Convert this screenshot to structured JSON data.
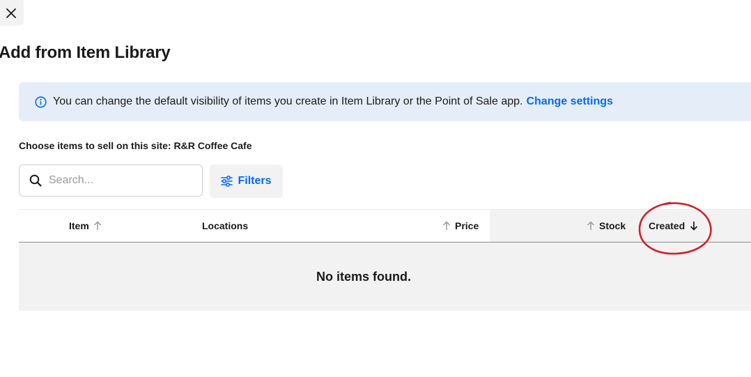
{
  "dialog": {
    "title": "Add from Item Library"
  },
  "banner": {
    "text": "You can change the default visibility of items you create in Item Library or the Point of Sale app.",
    "link_label": "Change settings",
    "icon": "info-icon"
  },
  "site_label": "Choose items to sell on this site: R&R Coffee Cafe",
  "search": {
    "placeholder": "Search...",
    "value": ""
  },
  "filters": {
    "label": "Filters"
  },
  "table": {
    "columns": [
      {
        "label": "Item",
        "sort": "up-arrow-icon"
      },
      {
        "label": "Locations"
      },
      {
        "label": "Price",
        "sort": "up-arrow-icon"
      },
      {
        "label": "Stock",
        "sort": "up-arrow-icon"
      },
      {
        "label": "Created",
        "sort": "down-arrow-icon",
        "active": true
      }
    ],
    "empty_message": "No items found."
  },
  "colors": {
    "accent": "#006aff",
    "banner_bg": "#e5eef8",
    "annotation": "#d0202a"
  }
}
